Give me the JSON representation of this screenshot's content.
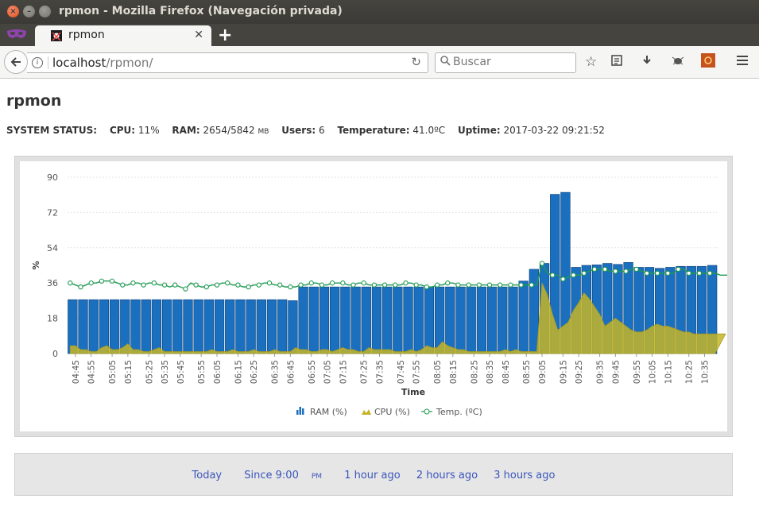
{
  "window": {
    "title": "rpmon - Mozilla Firefox (Navegación privada)"
  },
  "tab": {
    "title": "rpmon"
  },
  "nav": {
    "url_host": "localhost",
    "url_path": "/rpmon/",
    "search_placeholder": "Buscar"
  },
  "page": {
    "title": "rpmon",
    "status": {
      "label": "SYSTEM STATUS:",
      "cpu_label": "CPU:",
      "cpu_value": "11%",
      "ram_label": "RAM:",
      "ram_value": "2654/5842",
      "ram_unit": "MB",
      "users_label": "Users:",
      "users_value": "6",
      "temp_label": "Temperature:",
      "temp_value": "41.0ºC",
      "uptime_label": "Uptime:",
      "uptime_value": "2017-03-22 09:21:52"
    }
  },
  "range_links": [
    {
      "label": "Today"
    },
    {
      "label": "Since 9:00",
      "suffix": "PM"
    },
    {
      "label": "1 hour ago"
    },
    {
      "label": "2 hours ago"
    },
    {
      "label": "3 hours ago"
    }
  ],
  "colors": {
    "ram": "#1a6fbf",
    "ram_stroke": "#0d3f73",
    "cpu": "#c4b528",
    "temp": "#1f9a52"
  },
  "chart_data": {
    "type": "bar",
    "xlabel": "Time",
    "ylabel": "%",
    "ylim": [
      0,
      90
    ],
    "yticks": [
      0,
      18,
      36,
      54,
      72,
      90
    ],
    "grid": true,
    "legend_position": "bottom",
    "x_tick_labels": [
      "04:45",
      "04:55",
      "05:05",
      "05:15",
      "05:25",
      "05:35",
      "05:45",
      "05:55",
      "06:05",
      "06:15",
      "06:25",
      "06:35",
      "06:45",
      "06:55",
      "07:05",
      "07:15",
      "07:25",
      "07:35",
      "07:45",
      "07:55",
      "08:05",
      "08:15",
      "08:25",
      "08:35",
      "08:45",
      "08:55",
      "09:05",
      "09:15",
      "09:25",
      "09:35",
      "09:45",
      "09:55",
      "10:05",
      "10:15",
      "10:25",
      "10:35"
    ],
    "series": [
      {
        "name": "RAM (%)",
        "kind": "bar",
        "values": [
          27.5,
          27.5,
          27.5,
          27.5,
          27.5,
          27.5,
          27.5,
          27.5,
          27.5,
          27.5,
          27.5,
          27.5,
          27.5,
          27.5,
          27.5,
          27.5,
          27.5,
          27.5,
          27.5,
          27.5,
          27.5,
          27.5,
          27.5,
          27.5,
          27.5,
          27.5,
          27.5,
          27.5,
          27.5,
          27.5,
          27.5,
          27.5,
          27.5,
          27.5,
          27.5,
          27.5,
          27.5,
          27.5,
          27.5,
          27.5,
          27.5,
          27.5,
          27,
          27,
          34,
          34,
          34,
          34,
          34,
          34,
          34,
          34,
          34,
          34,
          34,
          34,
          34,
          34,
          34,
          34,
          34,
          34,
          34,
          34,
          34,
          34,
          34,
          34,
          34,
          34,
          34,
          34,
          34,
          34,
          34,
          34,
          34,
          34,
          34,
          34,
          34,
          34,
          34,
          34,
          34,
          34,
          37,
          37,
          43,
          43,
          46,
          46,
          81,
          81.5,
          82,
          82.5,
          44,
          44,
          45,
          45,
          45,
          45.5,
          46,
          46,
          45.5,
          45.5,
          46.5,
          46.5,
          44,
          44,
          44,
          44,
          43.5,
          43.5,
          44,
          44,
          44.5,
          44.5,
          44.5,
          44.5,
          44.5,
          44.5,
          45,
          45
        ]
      },
      {
        "name": "CPU (%)",
        "kind": "area",
        "values": [
          4,
          4,
          2,
          2,
          1,
          1,
          3,
          4,
          2,
          2,
          3,
          5,
          2,
          2,
          1,
          1,
          2,
          3,
          1,
          1,
          1,
          1,
          1,
          1,
          1,
          1,
          1,
          2,
          1,
          1,
          1,
          2,
          1,
          1,
          1,
          2,
          1,
          1,
          1,
          2,
          1,
          1,
          1,
          3,
          2,
          2,
          1,
          1,
          2,
          2,
          1,
          2,
          3,
          2,
          2,
          1,
          1,
          3,
          2,
          2,
          2,
          2,
          1,
          1,
          1,
          2,
          1,
          2,
          4,
          3,
          3,
          6,
          4,
          3,
          2,
          2,
          1,
          1,
          1,
          1,
          1,
          1,
          1,
          2,
          1,
          2,
          1,
          1,
          1,
          1,
          36,
          30,
          20,
          12,
          14,
          16,
          22,
          26,
          31,
          28,
          24,
          20,
          14,
          16,
          18,
          16,
          14,
          12,
          11,
          11,
          12,
          14,
          15,
          14,
          14,
          13,
          12,
          11,
          11,
          10,
          10,
          10,
          10,
          10,
          10,
          10
        ]
      },
      {
        "name": "Temp. (ºC)",
        "kind": "line",
        "values": [
          36,
          35,
          34,
          35,
          36,
          36,
          37,
          37,
          37,
          36,
          35,
          35,
          36,
          36,
          35,
          36,
          36,
          35,
          35,
          34,
          35,
          34,
          33,
          36,
          35,
          34,
          34,
          35,
          35,
          36,
          36,
          35,
          35,
          34,
          34,
          35,
          35,
          36,
          36,
          35,
          35,
          34,
          34,
          34,
          35,
          35,
          36,
          36,
          35,
          35,
          36,
          36,
          36,
          35,
          35,
          36,
          36,
          35,
          35,
          35,
          35,
          35,
          35,
          35,
          36,
          36,
          35,
          35,
          34,
          34,
          35,
          35,
          36,
          36,
          35,
          35,
          35,
          35,
          35,
          35,
          35,
          35,
          35,
          35,
          35,
          35,
          35,
          35,
          35,
          35,
          46,
          41,
          40,
          40,
          38,
          39,
          40,
          40,
          41,
          42,
          43,
          43,
          43,
          42,
          42,
          42,
          42,
          43,
          43,
          42,
          41,
          41,
          41,
          41,
          41,
          41,
          43,
          43,
          41,
          41,
          41,
          41,
          41,
          41,
          40,
          40,
          40,
          40,
          40,
          40
        ]
      }
    ]
  }
}
